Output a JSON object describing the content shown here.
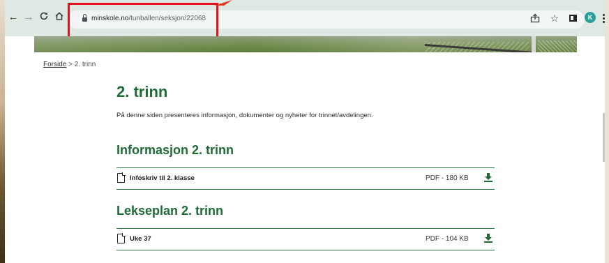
{
  "browser": {
    "url_domain": "minskole.no",
    "url_path": "/tunballen/seksjon/22068",
    "avatar_letter": "K",
    "star_glyph": "☆"
  },
  "breadcrumb": {
    "home_label": "Forside",
    "separator": " > ",
    "current": "2. trinn"
  },
  "page": {
    "title": "2. trinn",
    "intro": "På denne siden presenteres informasjon, dokumenter og nyheter for trinnet/avdelingen."
  },
  "sections": [
    {
      "heading": "Informasjon 2. trinn",
      "files": [
        {
          "name": "Infoskriv til 2. klasse",
          "meta": "PDF - 180 KB"
        }
      ]
    },
    {
      "heading": "Lekseplan 2. trinn",
      "files": [
        {
          "name": "Uke 37",
          "meta": "PDF - 104 KB"
        }
      ]
    }
  ],
  "colors": {
    "heading_green": "#1e6b36",
    "rule_green": "#2f7a45",
    "highlight_red": "#e4121b",
    "avatar_teal": "#2aa198"
  },
  "icons": [
    "back-arrow-icon",
    "forward-arrow-icon",
    "reload-icon",
    "home-icon",
    "lock-icon",
    "share-icon",
    "star-icon",
    "side-panel-icon",
    "kebab-menu-icon",
    "document-icon",
    "download-icon"
  ]
}
